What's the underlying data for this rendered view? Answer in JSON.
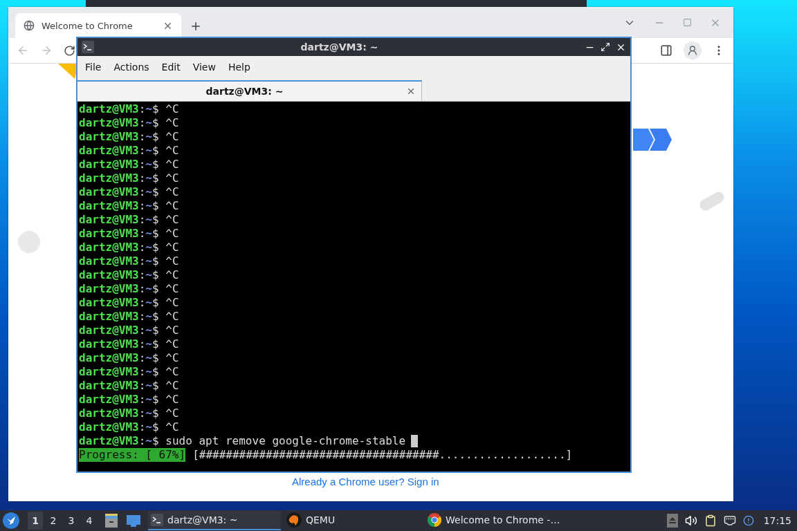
{
  "browser": {
    "tabs": [
      {
        "label": "Welcome to Chrome",
        "selected": true
      }
    ],
    "page": {
      "sign_in_link": "Already a Chrome user? Sign in"
    }
  },
  "terminal": {
    "title": "dartz@VM3: ~",
    "menu": [
      "File",
      "Actions",
      "Edit",
      "View",
      "Help"
    ],
    "tabs": [
      {
        "label": "dartz@VM3: ~",
        "selected": true
      }
    ],
    "lines": [
      {
        "user": "dartz@VM3",
        "separator": ":",
        "path": "~",
        "symbol": "$",
        "command": "^C",
        "cursor": false
      },
      {
        "user": "dartz@VM3",
        "separator": ":",
        "path": "~",
        "symbol": "$",
        "command": "^C",
        "cursor": false
      },
      {
        "user": "dartz@VM3",
        "separator": ":",
        "path": "~",
        "symbol": "$",
        "command": "^C",
        "cursor": false
      },
      {
        "user": "dartz@VM3",
        "separator": ":",
        "path": "~",
        "symbol": "$",
        "command": "^C",
        "cursor": false
      },
      {
        "user": "dartz@VM3",
        "separator": ":",
        "path": "~",
        "symbol": "$",
        "command": "^C",
        "cursor": false
      },
      {
        "user": "dartz@VM3",
        "separator": ":",
        "path": "~",
        "symbol": "$",
        "command": "^C",
        "cursor": false
      },
      {
        "user": "dartz@VM3",
        "separator": ":",
        "path": "~",
        "symbol": "$",
        "command": "^C",
        "cursor": false
      },
      {
        "user": "dartz@VM3",
        "separator": ":",
        "path": "~",
        "symbol": "$",
        "command": "^C",
        "cursor": false
      },
      {
        "user": "dartz@VM3",
        "separator": ":",
        "path": "~",
        "symbol": "$",
        "command": "^C",
        "cursor": false
      },
      {
        "user": "dartz@VM3",
        "separator": ":",
        "path": "~",
        "symbol": "$",
        "command": "^C",
        "cursor": false
      },
      {
        "user": "dartz@VM3",
        "separator": ":",
        "path": "~",
        "symbol": "$",
        "command": "^C",
        "cursor": false
      },
      {
        "user": "dartz@VM3",
        "separator": ":",
        "path": "~",
        "symbol": "$",
        "command": "^C",
        "cursor": false
      },
      {
        "user": "dartz@VM3",
        "separator": ":",
        "path": "~",
        "symbol": "$",
        "command": "^C",
        "cursor": false
      },
      {
        "user": "dartz@VM3",
        "separator": ":",
        "path": "~",
        "symbol": "$",
        "command": "^C",
        "cursor": false
      },
      {
        "user": "dartz@VM3",
        "separator": ":",
        "path": "~",
        "symbol": "$",
        "command": "^C",
        "cursor": false
      },
      {
        "user": "dartz@VM3",
        "separator": ":",
        "path": "~",
        "symbol": "$",
        "command": "^C",
        "cursor": false
      },
      {
        "user": "dartz@VM3",
        "separator": ":",
        "path": "~",
        "symbol": "$",
        "command": "^C",
        "cursor": false
      },
      {
        "user": "dartz@VM3",
        "separator": ":",
        "path": "~",
        "symbol": "$",
        "command": "^C",
        "cursor": false
      },
      {
        "user": "dartz@VM3",
        "separator": ":",
        "path": "~",
        "symbol": "$",
        "command": "^C",
        "cursor": false
      },
      {
        "user": "dartz@VM3",
        "separator": ":",
        "path": "~",
        "symbol": "$",
        "command": "^C",
        "cursor": false
      },
      {
        "user": "dartz@VM3",
        "separator": ":",
        "path": "~",
        "symbol": "$",
        "command": "^C",
        "cursor": false
      },
      {
        "user": "dartz@VM3",
        "separator": ":",
        "path": "~",
        "symbol": "$",
        "command": "^C",
        "cursor": false
      },
      {
        "user": "dartz@VM3",
        "separator": ":",
        "path": "~",
        "symbol": "$",
        "command": "^C",
        "cursor": false
      },
      {
        "user": "dartz@VM3",
        "separator": ":",
        "path": "~",
        "symbol": "$",
        "command": "^C",
        "cursor": false
      },
      {
        "user": "dartz@VM3",
        "separator": ":",
        "path": "~",
        "symbol": "$",
        "command": "sudo apt remove google-chrome-stable",
        "cursor": true
      }
    ],
    "progress": {
      "label": "Progress: [ 67%]",
      "bar": "[####################################...................]"
    }
  },
  "taskbar": {
    "workspaces": [
      {
        "label": "1",
        "selected": true
      },
      {
        "label": "2",
        "selected": false
      },
      {
        "label": "3",
        "selected": false
      },
      {
        "label": "4",
        "selected": false
      }
    ],
    "tasks": [
      {
        "kind": "terminal",
        "label": "dartz@VM3: ~",
        "selected": true
      },
      {
        "kind": "qemu",
        "label": "QEMU",
        "selected": false
      },
      {
        "kind": "chrome",
        "label": "Welcome to Chrome -…",
        "selected": false
      }
    ],
    "clock": "17:15"
  }
}
